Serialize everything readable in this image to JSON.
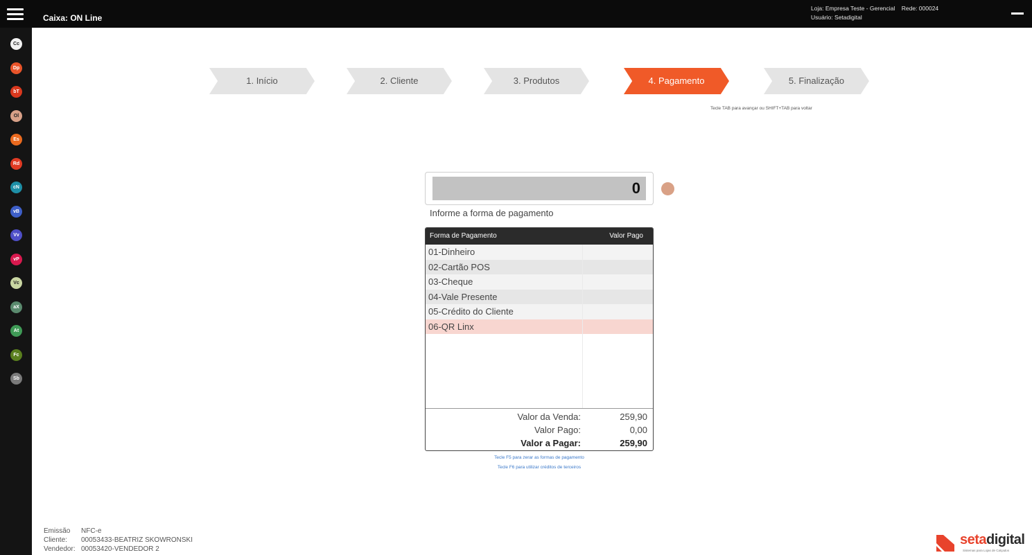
{
  "header": {
    "caixa": "Caixa: ON Line",
    "loja_label": "Loja:",
    "loja_value": "Empresa Teste - Gerencial",
    "rede_label": "Rede:",
    "rede_value": "000024",
    "usuario_label": "Usuário:",
    "usuario_value": "Setadigital"
  },
  "sidebar": {
    "items": [
      {
        "code": "Cc",
        "color": "#f2f2f2",
        "text_color": "#222222"
      },
      {
        "code": "Dp",
        "color": "#e8542a",
        "text_color": "#ffffff"
      },
      {
        "code": "bT",
        "color": "#d9381e",
        "text_color": "#ffffff"
      },
      {
        "code": "Ol",
        "color": "#d8a088",
        "text_color": "#222222"
      },
      {
        "code": "Es",
        "color": "#ea6a1f",
        "text_color": "#ffffff"
      },
      {
        "code": "Rd",
        "color": "#e03b24",
        "text_color": "#ffffff"
      },
      {
        "code": "cN",
        "color": "#1e8fa6",
        "text_color": "#ffffff"
      },
      {
        "code": "vB",
        "color": "#3e5fc8",
        "text_color": "#ffffff"
      },
      {
        "code": "Vv",
        "color": "#4f4fc8",
        "text_color": "#ffffff"
      },
      {
        "code": "vP",
        "color": "#d8194e",
        "text_color": "#ffffff"
      },
      {
        "code": "Vc",
        "color": "#c9d6a2",
        "text_color": "#222222"
      },
      {
        "code": "aX",
        "color": "#5a8a6e",
        "text_color": "#ffffff"
      },
      {
        "code": "At",
        "color": "#3f9a56",
        "text_color": "#ffffff"
      },
      {
        "code": "Fc",
        "color": "#5a7f1e",
        "text_color": "#ffffff"
      },
      {
        "code": "Sb",
        "color": "#7a7a7a",
        "text_color": "#ffffff"
      }
    ]
  },
  "steps": {
    "items": [
      {
        "label": "1. Início",
        "active": false
      },
      {
        "label": "2. Cliente",
        "active": false
      },
      {
        "label": "3. Produtos",
        "active": false
      },
      {
        "label": "4. Pagamento",
        "active": true
      },
      {
        "label": "5. Finalização",
        "active": false
      }
    ],
    "hint": "Tecle TAB para avançar ou SHIFT+TAB para voltar"
  },
  "payment": {
    "input_value": "0",
    "prompt": "Informe a forma de pagamento",
    "col_method": "Forma de Pagamento",
    "col_paid": "Valor Pago",
    "methods": [
      {
        "label": "01-Dinheiro",
        "selected": false
      },
      {
        "label": "02-Cartão POS",
        "selected": false
      },
      {
        "label": "03-Cheque",
        "selected": false
      },
      {
        "label": "04-Vale Presente",
        "selected": false
      },
      {
        "label": "05-Crédito do Cliente",
        "selected": false
      },
      {
        "label": "06-QR Linx",
        "selected": true
      }
    ],
    "totals": {
      "venda_label": "Valor da Venda:",
      "venda_value": "259,90",
      "pago_label": "Valor Pago:",
      "pago_value": "0,00",
      "pagar_label": "Valor a Pagar:",
      "pagar_value": "259,90"
    },
    "hint_f5": "Tecle F5 para zerar as formas de pagamento",
    "hint_f6": "Tecle F6 para utilizar créditos de terceiros"
  },
  "footer": {
    "emissao_label": "Emissão",
    "emissao_value": "NFC-e",
    "cliente_label": "Cliente:",
    "cliente_value": "00053433-BEATRIZ SKOWRONSKI",
    "vendedor_label": "Vendedor:",
    "vendedor_value": "00053420-VENDEDOR 2"
  },
  "brand": {
    "name_part1": "seta",
    "name_part2": "digital",
    "tagline": "Sistemas para Lojas de Calçados",
    "accent": "#e8432c"
  }
}
